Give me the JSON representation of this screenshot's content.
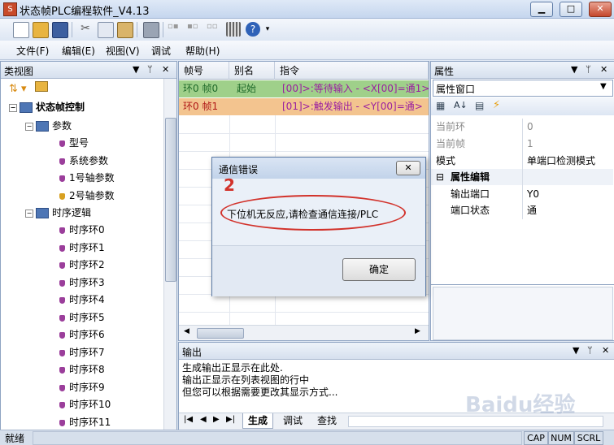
{
  "window": {
    "title": "状态帧PLC编程软件_V4.13"
  },
  "menu": [
    "文件(F)",
    "编辑(E)",
    "视图(V)",
    "调试",
    "帮助(H)"
  ],
  "left_panel": {
    "title": "类视图",
    "tree": {
      "root": "状态帧控制",
      "params_group": "参数",
      "params": [
        "型号",
        "系统参数",
        "1号轴参数",
        "2号轴参数"
      ],
      "seq_group": "时序逻辑",
      "seq": [
        "时序环0",
        "时序环1",
        "时序环2",
        "时序环3",
        "时序环4",
        "时序环5",
        "时序环6",
        "时序环7",
        "时序环8",
        "时序环9",
        "时序环10",
        "时序环11"
      ]
    }
  },
  "table": {
    "headers": [
      "帧号",
      "别名",
      "指令"
    ],
    "rows": [
      {
        "frame": "环0 帧0",
        "alias": "起始",
        "cmd": "[00]>:等待输入 - <X[00]=通1>",
        "bg": "#9fd08a",
        "fg": "#1f5a2a"
      },
      {
        "frame": "环0 帧1",
        "alias": "",
        "cmd": "[01]>:触发输出 - <Y[00]=通>",
        "bg": "#f3c48f",
        "fg": "#9a1fa0"
      }
    ]
  },
  "properties": {
    "title": "属性",
    "selector": "属性窗口",
    "rows": [
      {
        "key": "当前环",
        "value": "0",
        "grey": true
      },
      {
        "key": "当前帧",
        "value": "1",
        "grey": true
      },
      {
        "key": "模式",
        "value": "单端口检测模式",
        "grey": false
      }
    ],
    "section": "属性编辑",
    "edit_rows": [
      {
        "key": "输出端口",
        "value": "Y0"
      },
      {
        "key": "端口状态",
        "value": "通"
      }
    ]
  },
  "output": {
    "title": "输出",
    "lines": [
      "生成输出正显示在此处.",
      "输出正显示在列表视图的行中",
      "但您可以根据需要更改其显示方式..."
    ],
    "tabs": [
      "生成",
      "调试",
      "查找"
    ]
  },
  "status": {
    "ready": "就绪",
    "cap": "CAP",
    "num": "NUM",
    "scrl": "SCRL"
  },
  "dialog": {
    "title": "通信错误",
    "annotation": "2",
    "message": "下位机无反应,请检查通信连接/PLC",
    "ok": "确定"
  },
  "watermark": "Baidu经验",
  "colors": {
    "accent_red": "#d2322b",
    "frame_green": "#9fd08a",
    "frame_orange": "#f3c48f"
  }
}
